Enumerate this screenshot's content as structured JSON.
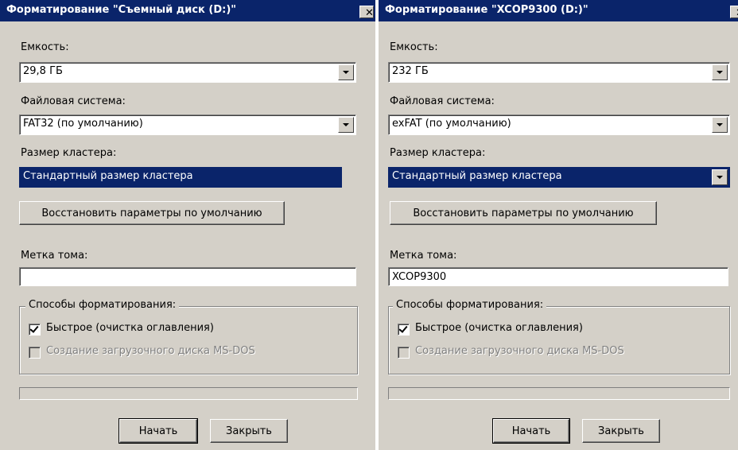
{
  "dialogs": [
    {
      "title": "Форматирование \"Съемный диск (D:)\"",
      "close_glyph": "✕",
      "capacity_label": "Емкость:",
      "capacity_value": "29,8 ГБ",
      "filesystem_label": "Файловая система:",
      "filesystem_value": "FAT32 (по умолчанию)",
      "cluster_label": "Размер кластера:",
      "cluster_value": "Стандартный размер кластера",
      "restore_button": "Восстановить параметры по умолчанию",
      "volume_label": "Метка тома:",
      "volume_value": "",
      "format_options_label": "Способы форматирования:",
      "quick_format_label": "Быстрое (очистка оглавления)",
      "quick_format_checked": true,
      "msdos_label": "Создание загрузочного диска MS-DOS",
      "msdos_checked": false,
      "start_button": "Начать",
      "close_button": "Закрыть"
    },
    {
      "title": "Форматирование \"XCOP9300 (D:)\"",
      "close_glyph": "✕",
      "capacity_label": "Емкость:",
      "capacity_value": "232 ГБ",
      "filesystem_label": "Файловая система:",
      "filesystem_value": "exFAT (по умолчанию)",
      "cluster_label": "Размер кластера:",
      "cluster_value": "Стандартный размер кластера",
      "restore_button": "Восстановить параметры по умолчанию",
      "volume_label": "Метка тома:",
      "volume_value": "XCOP9300",
      "format_options_label": "Способы форматирования:",
      "quick_format_label": "Быстрое (очистка оглавления)",
      "quick_format_checked": true,
      "msdos_label": "Создание загрузочного диска MS-DOS",
      "msdos_checked": false,
      "start_button": "Начать",
      "close_button": "Закрыть"
    }
  ],
  "colors": {
    "titlebar": "#0a246a",
    "dialog_bg": "#d4d0c8",
    "selection": "#0a246a",
    "disabled_text": "#808080"
  },
  "icons": {
    "close": "close-icon",
    "dropdown": "chevron-down-icon",
    "checkbox": "checkmark-icon"
  }
}
